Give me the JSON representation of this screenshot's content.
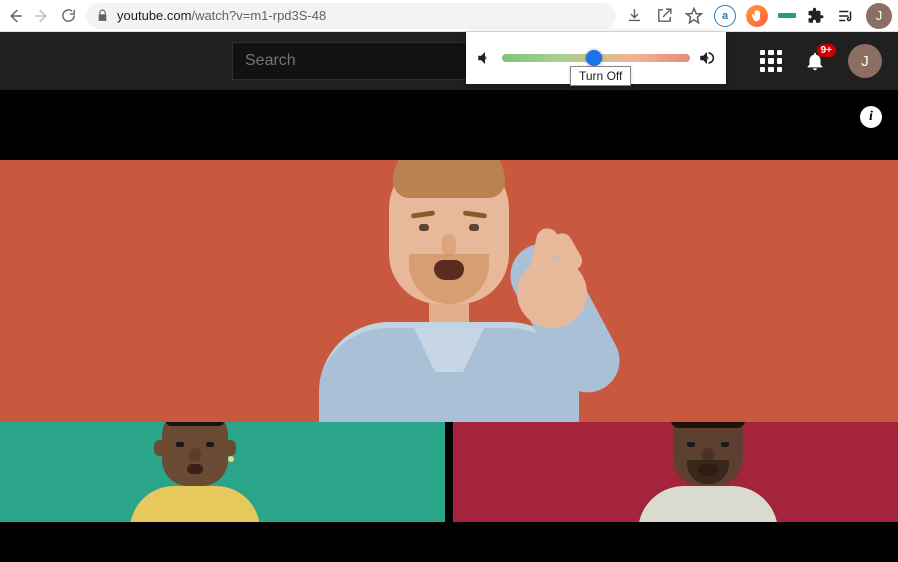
{
  "browser": {
    "url_host": "youtube.com",
    "url_path": "/watch?v=m1-rpd3S-48",
    "avatar_letter": "J"
  },
  "yt": {
    "search_placeholder": "Search",
    "notification_count": "9+",
    "avatar_letter": "J"
  },
  "popover": {
    "turn_off_label": "Turn Off"
  },
  "info_icon_text": "i"
}
